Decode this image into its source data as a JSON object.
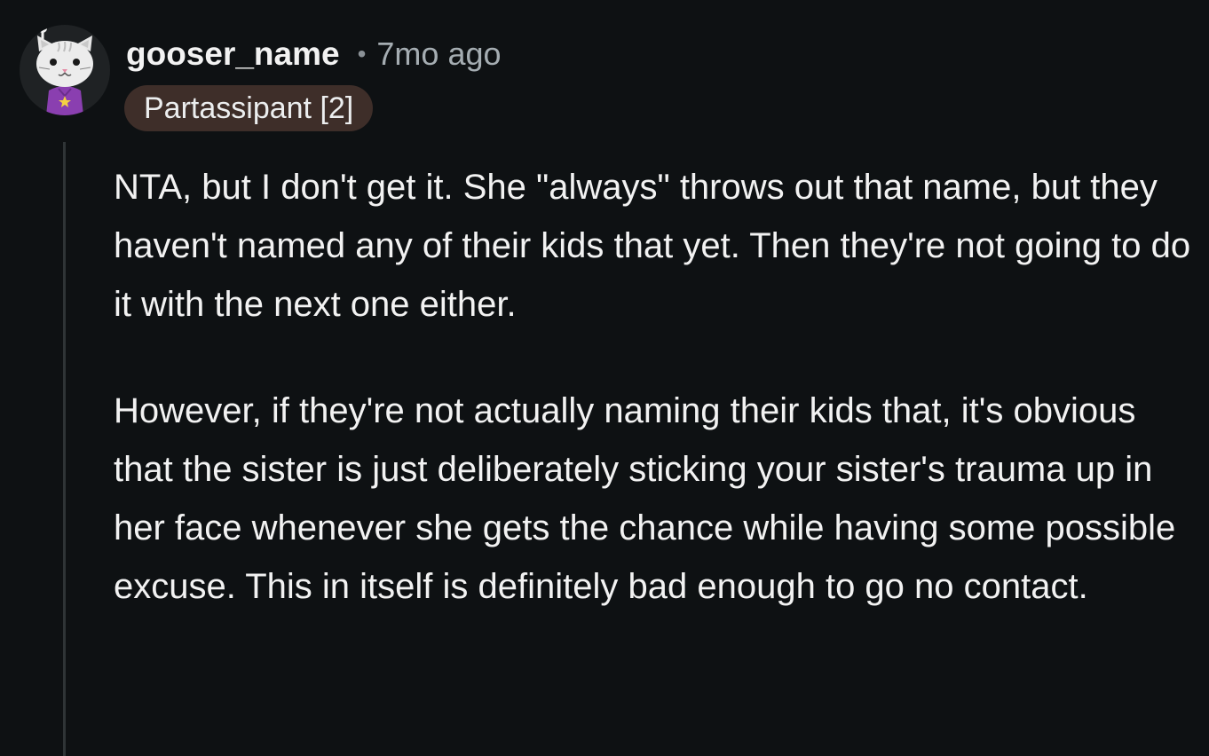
{
  "comment": {
    "username": "gooser_name",
    "separator": "•",
    "timestamp": "7mo ago",
    "flair": "Partassipant [2]",
    "paragraphs": [
      "NTA, but I don't get it. She \"always\" throws out that name, but they haven't named any of their kids that yet. Then they're not going to do it with the next one either.",
      "However, if they're not actually naming their kids that, it's obvious that the sister is just deliberately sticking your sister's trauma up in her face whenever she gets the chance while having some possible excuse. This in itself is definitely bad enough to go no contact."
    ]
  },
  "icons": {
    "avatar": "cat-avatar-icon"
  },
  "colors": {
    "background": "#0e1113",
    "text": "#f2f2f2",
    "meta_text": "#a5adb2",
    "flair_background": "#3e2e29",
    "thread_line": "#2f3436",
    "avatar_shirt": "#8a3fb0"
  }
}
